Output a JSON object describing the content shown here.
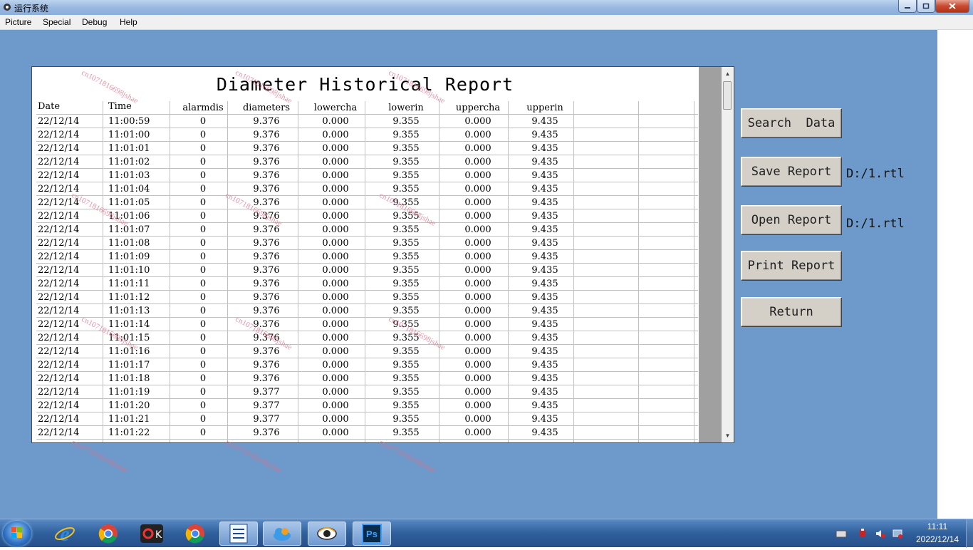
{
  "window": {
    "title": "运行系统"
  },
  "menu": [
    "Picture",
    "Special",
    "Debug",
    "Help"
  ],
  "report": {
    "title": "Diameter Historical Report",
    "columns": [
      "Date",
      "Time",
      "alarmdis",
      "diameters",
      "lowercha",
      "lowerin",
      "uppercha",
      "upperin"
    ],
    "rows": [
      [
        "22/12/14",
        "11:00:59",
        "0",
        "9.376",
        "0.000",
        "9.355",
        "0.000",
        "9.435"
      ],
      [
        "22/12/14",
        "11:01:00",
        "0",
        "9.376",
        "0.000",
        "9.355",
        "0.000",
        "9.435"
      ],
      [
        "22/12/14",
        "11:01:01",
        "0",
        "9.376",
        "0.000",
        "9.355",
        "0.000",
        "9.435"
      ],
      [
        "22/12/14",
        "11:01:02",
        "0",
        "9.376",
        "0.000",
        "9.355",
        "0.000",
        "9.435"
      ],
      [
        "22/12/14",
        "11:01:03",
        "0",
        "9.376",
        "0.000",
        "9.355",
        "0.000",
        "9.435"
      ],
      [
        "22/12/14",
        "11:01:04",
        "0",
        "9.376",
        "0.000",
        "9.355",
        "0.000",
        "9.435"
      ],
      [
        "22/12/14",
        "11:01:05",
        "0",
        "9.376",
        "0.000",
        "9.355",
        "0.000",
        "9.435"
      ],
      [
        "22/12/14",
        "11:01:06",
        "0",
        "9.376",
        "0.000",
        "9.355",
        "0.000",
        "9.435"
      ],
      [
        "22/12/14",
        "11:01:07",
        "0",
        "9.376",
        "0.000",
        "9.355",
        "0.000",
        "9.435"
      ],
      [
        "22/12/14",
        "11:01:08",
        "0",
        "9.376",
        "0.000",
        "9.355",
        "0.000",
        "9.435"
      ],
      [
        "22/12/14",
        "11:01:09",
        "0",
        "9.376",
        "0.000",
        "9.355",
        "0.000",
        "9.435"
      ],
      [
        "22/12/14",
        "11:01:10",
        "0",
        "9.376",
        "0.000",
        "9.355",
        "0.000",
        "9.435"
      ],
      [
        "22/12/14",
        "11:01:11",
        "0",
        "9.376",
        "0.000",
        "9.355",
        "0.000",
        "9.435"
      ],
      [
        "22/12/14",
        "11:01:12",
        "0",
        "9.376",
        "0.000",
        "9.355",
        "0.000",
        "9.435"
      ],
      [
        "22/12/14",
        "11:01:13",
        "0",
        "9.376",
        "0.000",
        "9.355",
        "0.000",
        "9.435"
      ],
      [
        "22/12/14",
        "11:01:14",
        "0",
        "9.376",
        "0.000",
        "9.355",
        "0.000",
        "9.435"
      ],
      [
        "22/12/14",
        "11:01:15",
        "0",
        "9.376",
        "0.000",
        "9.355",
        "0.000",
        "9.435"
      ],
      [
        "22/12/14",
        "11:01:16",
        "0",
        "9.376",
        "0.000",
        "9.355",
        "0.000",
        "9.435"
      ],
      [
        "22/12/14",
        "11:01:17",
        "0",
        "9.376",
        "0.000",
        "9.355",
        "0.000",
        "9.435"
      ],
      [
        "22/12/14",
        "11:01:18",
        "0",
        "9.376",
        "0.000",
        "9.355",
        "0.000",
        "9.435"
      ],
      [
        "22/12/14",
        "11:01:19",
        "0",
        "9.377",
        "0.000",
        "9.355",
        "0.000",
        "9.435"
      ],
      [
        "22/12/14",
        "11:01:20",
        "0",
        "9.377",
        "0.000",
        "9.355",
        "0.000",
        "9.435"
      ],
      [
        "22/12/14",
        "11:01:21",
        "0",
        "9.377",
        "0.000",
        "9.355",
        "0.000",
        "9.435"
      ],
      [
        "22/12/14",
        "11:01:22",
        "0",
        "9.376",
        "0.000",
        "9.355",
        "0.000",
        "9.435"
      ]
    ]
  },
  "buttons": {
    "search": "Search  Data",
    "save": "Save Report",
    "open": "Open Report",
    "print": "Print Report",
    "return": "Return"
  },
  "paths": {
    "save": "D:/1.rtl",
    "open": "D:/1.rtl"
  },
  "watermark": "cn1071816698jshae",
  "taskbar": {
    "apps": [
      "internet-explorer-icon",
      "chrome-icon",
      "media-app-icon",
      "chrome-icon",
      "document-app-icon",
      "cloud-app-icon",
      "eye-app-icon",
      "photoshop-icon"
    ],
    "ps_label": "Ps",
    "time": "11:11",
    "date": "2022/12/14"
  },
  "colors": {
    "desktop": "#6d9acb",
    "button_face": "#d4d0c8",
    "watermark": "#e07088"
  }
}
